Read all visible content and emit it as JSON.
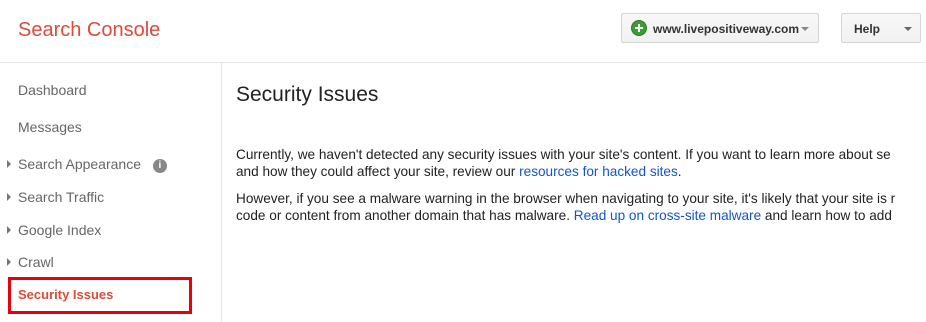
{
  "header": {
    "app_title": "Search Console",
    "site_selector": {
      "icon": "add-property-icon",
      "value": "www.livepositiveway.com"
    },
    "help_label": "Help"
  },
  "sidebar": {
    "items": [
      {
        "label": "Dashboard",
        "expandable": false
      },
      {
        "label": "Messages",
        "expandable": false
      },
      {
        "label": "Search Appearance",
        "expandable": true,
        "info_icon": "i"
      },
      {
        "label": "Search Traffic",
        "expandable": true
      },
      {
        "label": "Google Index",
        "expandable": true
      },
      {
        "label": "Crawl",
        "expandable": true
      },
      {
        "label": "Security Issues",
        "expandable": false,
        "active": true
      }
    ]
  },
  "main": {
    "title": "Security Issues",
    "para1": {
      "line1": "Currently, we haven't detected any security issues with your site's content. If you want to learn more about se",
      "line2_before": "and how they could affect your site, review our ",
      "line2_link": "resources for hacked sites",
      "line2_after": "."
    },
    "para2": {
      "line1": "However, if you see a malware warning in the browser when navigating to your site, it's likely that your site is r",
      "line2_before": "code or content from another domain that has malware. ",
      "line2_link": "Read up on cross-site malware",
      "line2_after": " and learn how to add"
    }
  },
  "colors": {
    "brand_red": "#dd4b39",
    "link_blue": "#1155cc",
    "highlight_red": "#e8000b"
  }
}
